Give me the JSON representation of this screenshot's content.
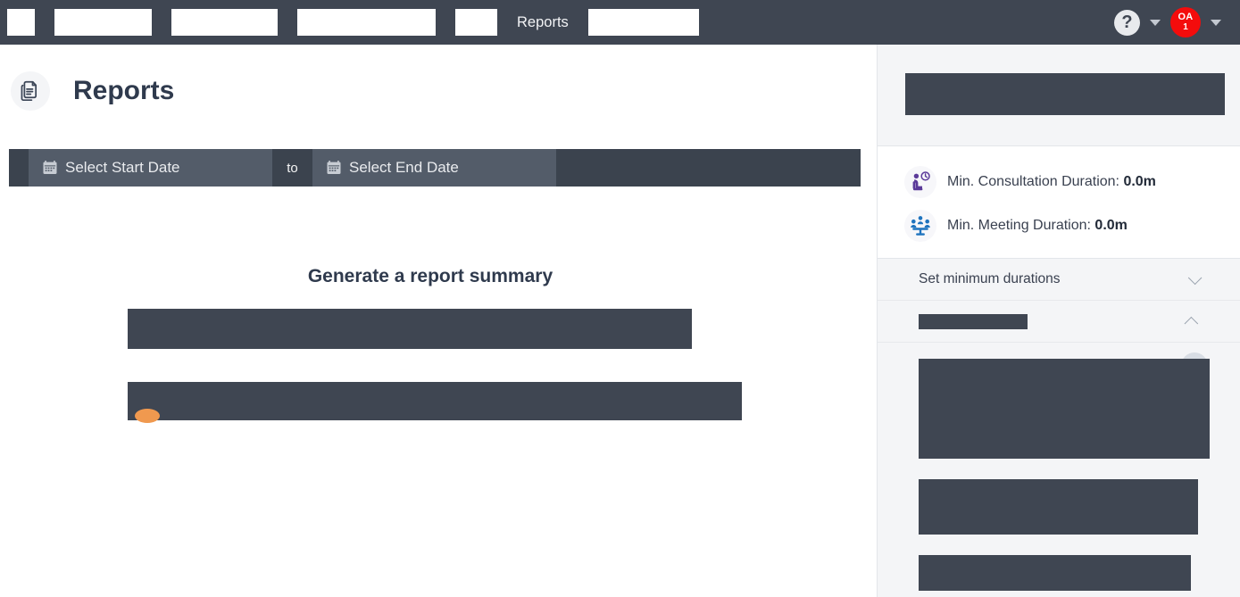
{
  "navbar": {
    "redacted_items": [
      "",
      "",
      "",
      "",
      ""
    ],
    "visible_item": "Reports",
    "trailing_redacted": "",
    "help_icon_label": "?",
    "avatar_initials": "OA",
    "avatar_count": "1",
    "colors": {
      "background": "#3f4652",
      "avatar": "#f40c0c",
      "help_circle": "#e8eaed"
    }
  },
  "page": {
    "title": "Reports",
    "icon": "documents-icon"
  },
  "date_range": {
    "start_placeholder": "Select Start Date",
    "end_placeholder": "Select End Date",
    "separator": "to",
    "start_value": "",
    "end_value": ""
  },
  "main": {
    "summary_heading": "Generate a report summary",
    "redacted_block_1": "",
    "redacted_block_2": ""
  },
  "sidebar": {
    "top_redacted": "",
    "durations": [
      {
        "icon": "seated-person-clock-icon",
        "label": "Min. Consultation Duration:",
        "value": "0.0m",
        "color": "#5b3a99"
      },
      {
        "icon": "meeting-people-icon",
        "label": "Min. Meeting Duration:",
        "value": "0.0m",
        "color": "#1e73be"
      }
    ],
    "accordions": [
      {
        "label": "Set minimum durations",
        "state": "collapsed",
        "chevron": "chevron-down-icon",
        "redacted": false
      },
      {
        "label": "",
        "state": "expanded",
        "chevron": "chevron-up-icon",
        "redacted": true
      }
    ],
    "redacted_blocks": [
      "",
      "",
      ""
    ]
  }
}
